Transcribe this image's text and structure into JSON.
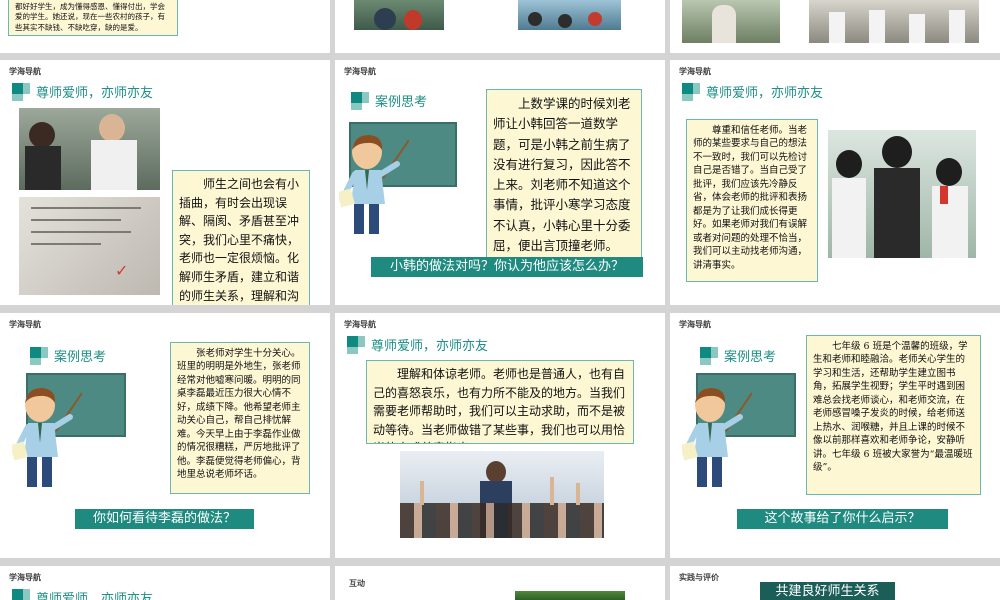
{
  "colors": {
    "accent": "#1e8a80",
    "box_fill": "#fdf7d4",
    "box_border": "#6bb8b0",
    "title": "#1d8f86"
  },
  "row0": {
    "s1_text": "自己更注意教育教育，希望自己能够好的孩子都好好学生，成为懂得感恩、懂得付出，学会爱的学生。她还说，现在一些农村的孩子，有些其实不缺钱、不缺吃穿，缺的是爱。"
  },
  "slide_a": {
    "tag": "学海导航",
    "title": "尊师爱师，亦师亦友",
    "text": "师生之间也会有小插曲，有时会出现误解、隔阂、矛盾甚至冲突，我们心里不痛快，老师也一定很烦恼。化解师生矛盾，建立和谐的师生关系，理解和沟通是关键。我们要从自己做起，为建立和谐的师生关系发挥主动作用。"
  },
  "slide_b": {
    "tag": "学海导航",
    "title": "案例思考",
    "text": "上数学课的时候刘老师让小韩回答一道数学题，可是小韩之前生病了没有进行复习，因此答不上来。刘老师不知道这个事情，批评小寒学习态度不认真，小韩心里十分委屈，便出言顶撞老师。",
    "banner": "小韩的做法对吗？你认为他应该怎么办？"
  },
  "slide_c": {
    "tag": "学海导航",
    "title": "尊师爱师，亦师亦友",
    "text": "尊重和信任老师。当老师的某些要求与自己的想法不一致时，我们可以先检讨自己是否错了。当自己受了批评，我们应该先冷静反省，体会老师的批评和表扬都是为了让我们成长得更好。如果老师对我们有误解或者对问题的处理不恰当，我们可以主动找老师沟通，讲清事实。"
  },
  "slide_d": {
    "tag": "学海导航",
    "title": "案例思考",
    "text": "张老师对学生十分关心。班里的明明是外地生，张老师经常对他嘘寒问暖。明明的同桌李磊最近压力很大心情不好，成绩下降。他希望老师主动关心自己，帮自己排忧解难。今天早上由于李磊作业做的情况很糟糕，严厉地批评了他。李磊便觉得老师偏心，背地里总说老师坏话。",
    "banner": "你如何看待李磊的做法？"
  },
  "slide_e": {
    "tag": "学海导航",
    "title": "尊师爱师，亦师亦友",
    "text": "理解和体谅老师。老师也是普通人，也有自己的喜怒哀乐，也有力所不能及的地方。当我们需要老师帮助时，我们可以主动求助，而不是被动等待。当老师做错了某些事，我们也可以用恰当的方式善意指出。"
  },
  "slide_f": {
    "tag": "学海导航",
    "title": "案例思考",
    "text": "七年级 6 班是个温馨的班级，学生和老师和睦融洽。老师关心学生的学习和生活，还帮助学生建立图书角，拓展学生视野；学生平时遇到困难总会找老师谈心，和老师交流，在老师感冒嗓子发炎的时候，给老师送上热水、润喉糖，并且上课的时候不像以前那样喜欢和老师争论，安静听讲。七年级 6 班被大家誉为“最温暖班级”。",
    "banner": "这个故事给了你什么启示？"
  },
  "row3": {
    "g_tag": "学海导航",
    "g_title": "尊师爱师，亦师亦友",
    "h_tag": "互动",
    "i_tag": "实践与评价",
    "i_banner": "共建良好师生关系"
  }
}
